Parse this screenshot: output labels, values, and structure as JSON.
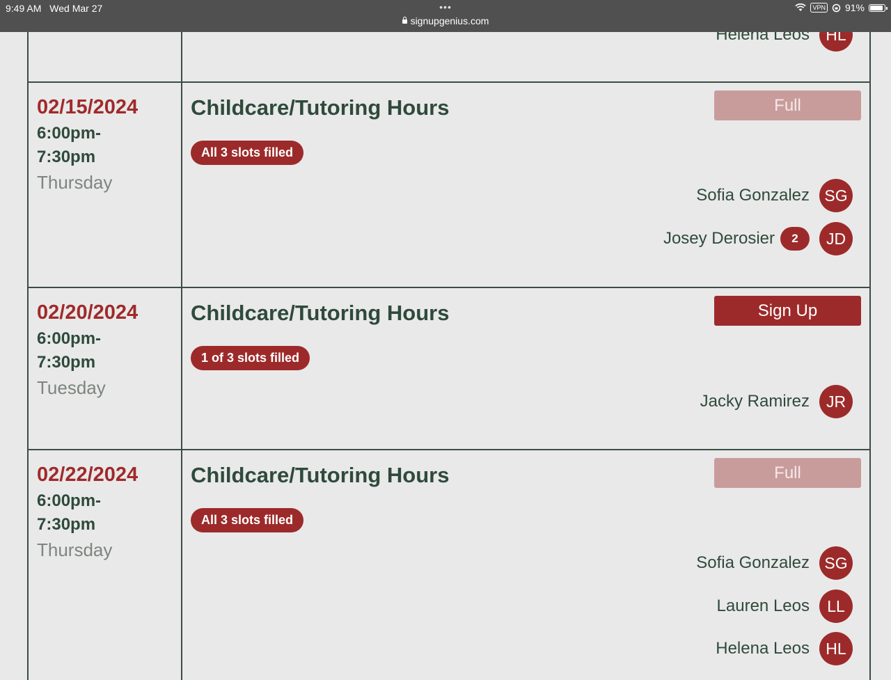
{
  "status_bar": {
    "time": "9:49 AM",
    "date": "Wed Mar 27",
    "dots": "•••",
    "url": "signupgenius.com",
    "vpn": "VPN",
    "battery": "91%",
    "battery_level": 0.91
  },
  "top_partial": {
    "person": {
      "name": "Helena Leos",
      "initials": "HL"
    }
  },
  "slots": [
    {
      "date": "02/15/2024",
      "time_start": "6:00pm-",
      "time_end": "7:30pm",
      "day": "Thursday",
      "title": "Childcare/Tutoring Hours",
      "status": "All 3 slots filled",
      "button": "Full",
      "people": [
        {
          "name": "Sofia Gonzalez",
          "initials": "SG"
        },
        {
          "name": "Josey Derosier",
          "count": "2",
          "initials": "JD"
        }
      ]
    },
    {
      "date": "02/20/2024",
      "time_start": "6:00pm-",
      "time_end": "7:30pm",
      "day": "Tuesday",
      "title": "Childcare/Tutoring Hours",
      "status": "1 of 3 slots filled",
      "button": "Sign Up",
      "people": [
        {
          "name": "Jacky Ramirez",
          "initials": "JR"
        }
      ]
    },
    {
      "date": "02/22/2024",
      "time_start": "6:00pm-",
      "time_end": "7:30pm",
      "day": "Thursday",
      "title": "Childcare/Tutoring Hours",
      "status": "All 3 slots filled",
      "button": "Full",
      "people": [
        {
          "name": "Sofia Gonzalez",
          "initials": "SG"
        },
        {
          "name": "Lauren Leos",
          "initials": "LL"
        },
        {
          "name": "Helena Leos",
          "initials": "HL"
        }
      ]
    }
  ]
}
